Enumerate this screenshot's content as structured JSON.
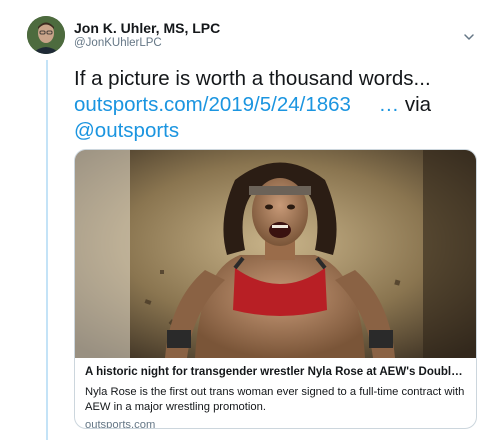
{
  "author": {
    "name": "Jon K. Uhler, MS, LPC",
    "handle": "@JonKUhlerLPC"
  },
  "icons": {
    "avatar": "profile-photo",
    "menu": "chevron-down-icon"
  },
  "tweet": {
    "text_prefix": "If a picture is worth a thousand words...",
    "link_url": "outsports.com/2019/5/24/1863",
    "link_ellipsis": "…",
    "via_word": "via",
    "mention": "@outsports"
  },
  "card": {
    "title": "A historic night for transgender wrestler Nyla Rose at AEW's Double ...",
    "description": "Nyla Rose is the first out trans woman ever signed to a full-time contract with AEW in a major wrestling promotion.",
    "domain": "outsports.com"
  },
  "colors": {
    "link": "#1b95e0",
    "secondary_text": "#657786",
    "thread_line": "#c4e3f7",
    "border": "#ccd6dd"
  }
}
